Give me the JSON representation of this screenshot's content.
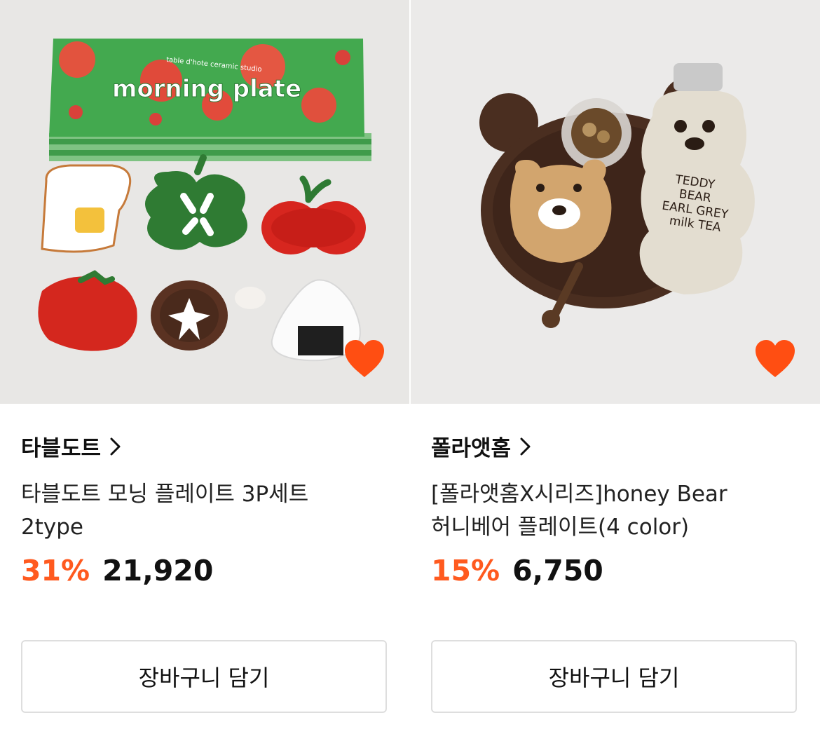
{
  "products": [
    {
      "brand": "타블도트",
      "title_line1": "타블도트 모닝 플레이트 3P세트",
      "title_line2": "2type",
      "discount": "31%",
      "price": "21,920",
      "cart_label": "장바구니 담기",
      "image_box_text": "morning plate",
      "image_box_small_text": "table d'hote ceramic studio",
      "liked": true,
      "image_icon": "tableware-set-image"
    },
    {
      "brand": "폴라앳홈",
      "title_line1": "[폴라앳홈X시리즈]honey Bear",
      "title_line2": "허니베어 플레이트(4 color)",
      "discount": "15%",
      "price": "6,750",
      "cart_label": "장바구니 담기",
      "image_bottle_text": [
        "TEDDY",
        "BEAR",
        "EARL GREY",
        "milk TEA"
      ],
      "liked": true,
      "image_icon": "bear-plate-image"
    }
  ],
  "colors": {
    "accent": "#ff5a1f",
    "heart": "#ff4e12",
    "border": "#dedede"
  }
}
